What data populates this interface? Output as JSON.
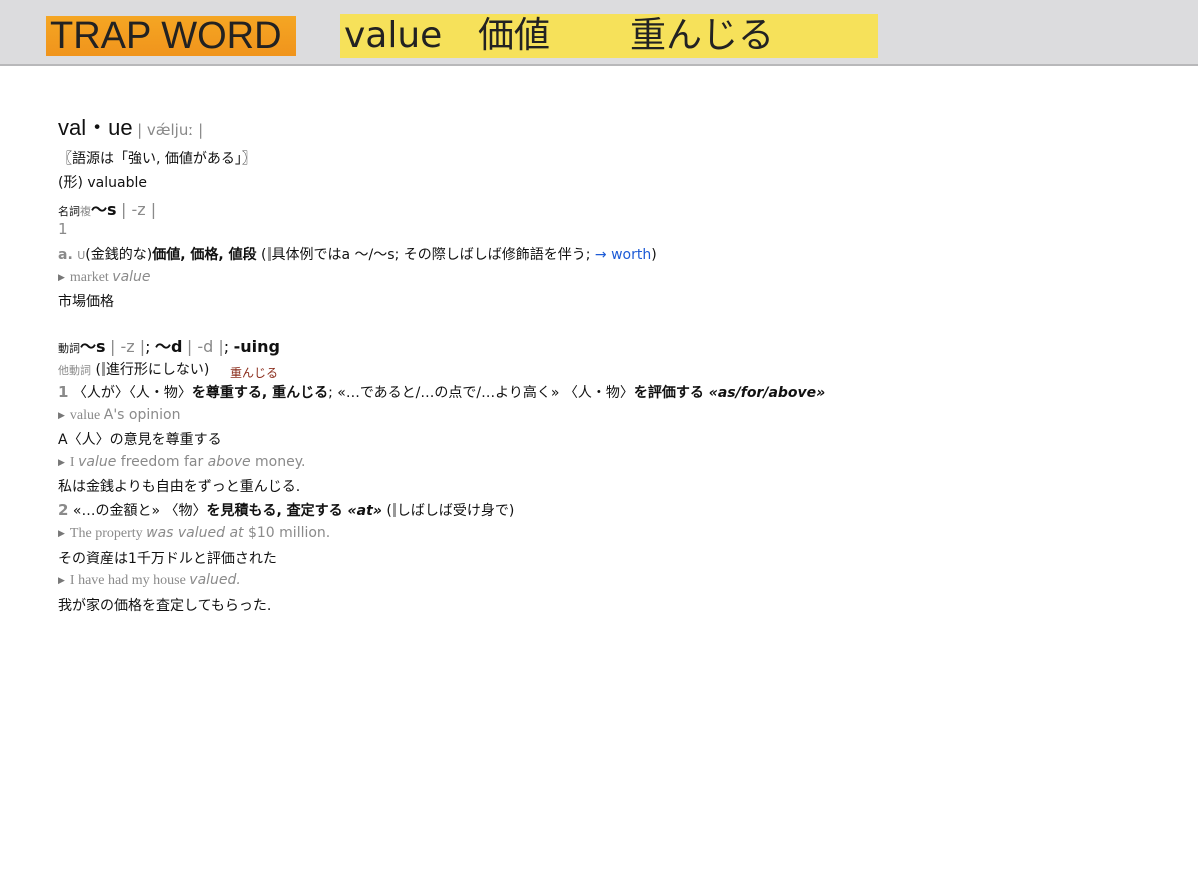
{
  "banner": {
    "trap_label": "TRAP WORD",
    "word": "value",
    "ja_meaning": "価値",
    "ja_verb": "重んじる"
  },
  "entry": {
    "headword": "val・ue",
    "pron": "| vǽljuː |",
    "etymology": "〖語源は「強い, 価値がある」〗",
    "adj_related": "(形) valuable",
    "noun_label": "名詞",
    "noun_plural_label": "複",
    "noun_plural": "〜s",
    "noun_plural_pron": "| -z |",
    "sense1_num": "1",
    "sense1a_letter": "a.",
    "sense1a_u": "U",
    "sense1a_paren": "(金銭的な)",
    "sense1a_defs": "価値, 価格, 値段",
    "sense1a_note_pre": " (",
    "sense1a_note": "具体例ではa 〜/〜s; その際しばしば修飾語を伴う; ",
    "sense1a_link": "→ worth",
    "sense1a_note_post": ")",
    "ex1_pre": "market ",
    "ex1_word": "value",
    "ex1_ja": "市場価格",
    "verb_label": "動詞",
    "verb_forms_s": "〜s",
    "verb_forms_s_pron": "| -z |",
    "verb_forms_d": "〜d",
    "verb_forms_d_pron": "| -d |",
    "verb_forms_ing": "-uing",
    "vt_label": "他動詞",
    "vt_note": "進行形にしない)",
    "red_note": "重んじる",
    "v1_num": "1",
    "v1_obj1": "〈人が〉",
    "v1_obj2": "〈人・物〉",
    "v1_defs": "を尊重する",
    "v1_defs2": ", 重んじる",
    "v1_rest": "; «…であると/…の点で/…より高く» 〈人・物〉",
    "v1_defs3": "を評価する",
    "v1_preps": " «as/for/above»",
    "ex2_pre": "value ",
    "ex2_rest": "A's opinion",
    "ex2_ja": "A〈人〉の意見を尊重する",
    "ex3_pre": "I ",
    "ex3_word": "value",
    "ex3_mid": " freedom far ",
    "ex3_word2": "above",
    "ex3_post": " money.",
    "ex3_ja": "私は金銭よりも自由をずっと重んじる.",
    "v2_num": "2",
    "v2_obj": "«…の金額と» 〈物〉",
    "v2_defs": "を見積もる, 査定する",
    "v2_prep": " «at»",
    "v2_note": "しばしば受け身で)",
    "ex4_pre": "The property ",
    "ex4_word": "was valued at",
    "ex4_post": " $10 million.",
    "ex4_ja": "その資産は1千万ドルと評価された",
    "ex5_pre": "I have had my house ",
    "ex5_word": "valued.",
    "ex5_ja": "我が家の価格を査定してもらった."
  },
  "colors": {
    "banner_orange": "#f5a623",
    "banner_yellow": "#f6e15a",
    "link_blue": "#1d5bd6",
    "note_red": "#8a2c1b"
  }
}
